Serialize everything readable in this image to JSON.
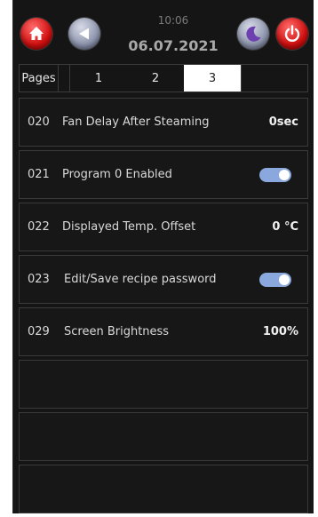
{
  "header": {
    "time": "10:06",
    "date": "06.07.2021"
  },
  "icons": {
    "home": "home-icon",
    "back": "back-arrow-icon",
    "night": "moon-icon",
    "power": "power-icon"
  },
  "colors": {
    "red_button": "#d10f0f",
    "grey_button": "#8e95ad",
    "toggle_on": "#8aa8dd",
    "background": "#151515"
  },
  "tabs": {
    "label": "Pages",
    "pages": [
      "1",
      "2",
      "3"
    ],
    "active": "3"
  },
  "settings": [
    {
      "code": "020",
      "label": "Fan Delay After Steaming",
      "type": "value",
      "value": "0sec"
    },
    {
      "code": "021",
      "label": "Program 0 Enabled",
      "type": "toggle",
      "value": "on"
    },
    {
      "code": "022",
      "label": "Displayed Temp. Offset",
      "type": "value",
      "value": "0 °C"
    },
    {
      "code": "023",
      "label": "Edit/Save recipe password",
      "type": "toggle",
      "value": "on"
    },
    {
      "code": "029",
      "label": "Screen Brightness",
      "type": "value",
      "value": "100%"
    }
  ]
}
